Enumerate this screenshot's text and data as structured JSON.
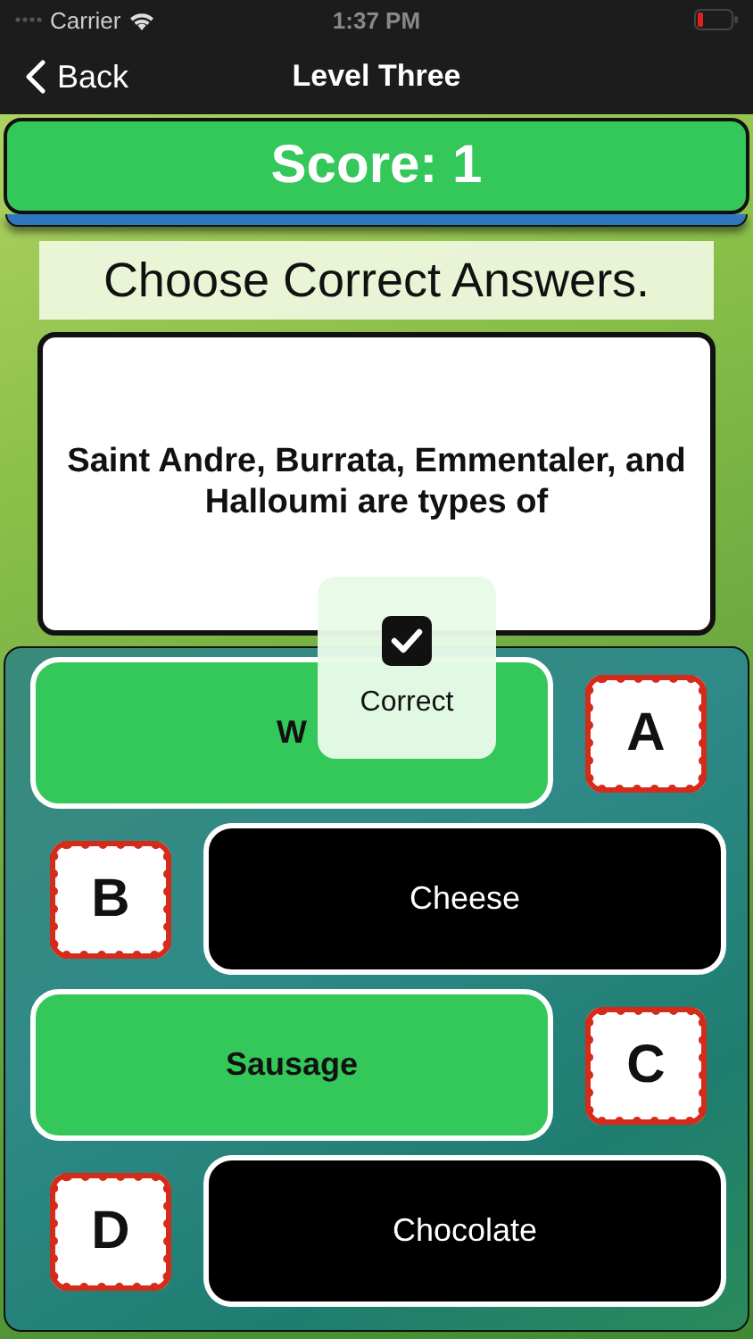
{
  "status_bar": {
    "carrier": "Carrier",
    "time": "1:37 PM"
  },
  "nav_bar": {
    "back": "Back",
    "title": "Level Three"
  },
  "score": "Score: 1",
  "instruction": "Choose Correct Answers.",
  "question": "Saint Andre, Burrata, Emmentaler, and Halloumi are types of",
  "answers": [
    {
      "letter": "A",
      "text": "W",
      "kind": "green"
    },
    {
      "letter": "B",
      "text": "Cheese",
      "kind": "black"
    },
    {
      "letter": "C",
      "text": "Sausage",
      "kind": "green"
    },
    {
      "letter": "D",
      "text": "Chocolate",
      "kind": "black"
    }
  ],
  "toast": {
    "label": "Correct",
    "checked": true
  }
}
